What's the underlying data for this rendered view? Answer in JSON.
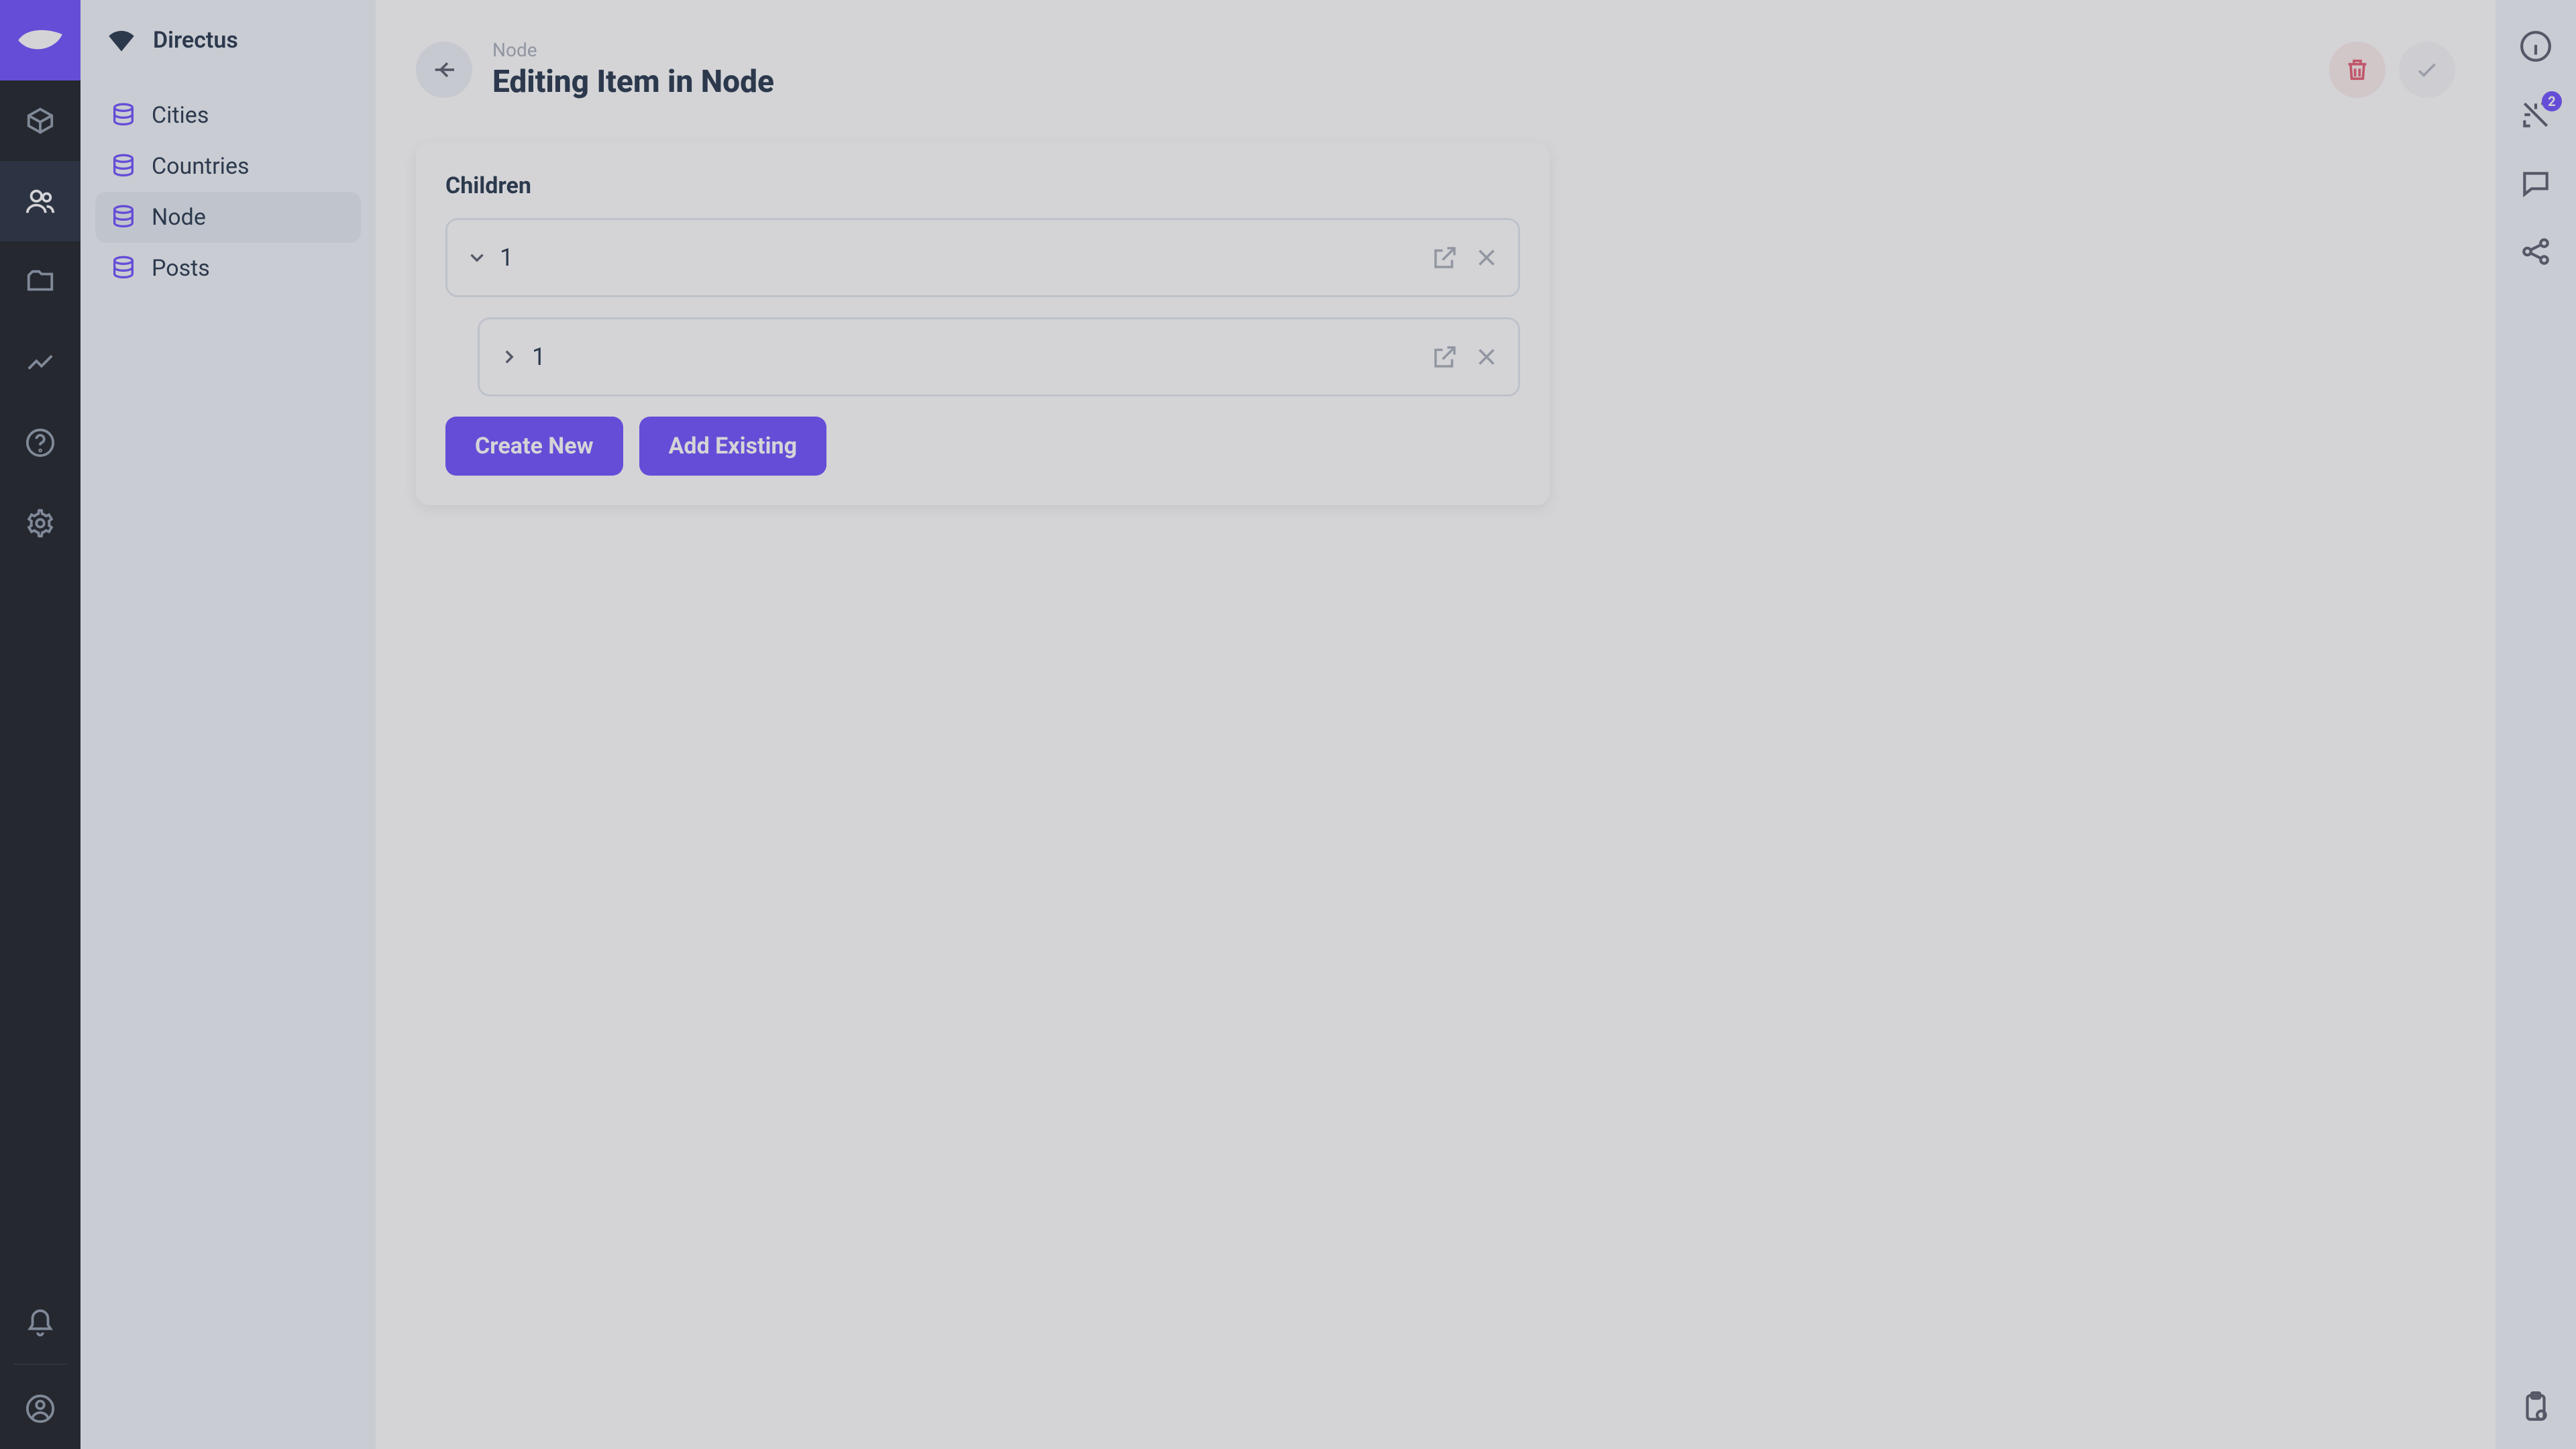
{
  "brand": "Directus",
  "nav": {
    "items": [
      "content",
      "users",
      "files",
      "insights",
      "help",
      "settings"
    ],
    "active_index": 1
  },
  "sidebar": {
    "title": "Directus",
    "collections": [
      {
        "label": "Cities",
        "active": false
      },
      {
        "label": "Countries",
        "active": false
      },
      {
        "label": "Node",
        "active": true
      },
      {
        "label": "Posts",
        "active": false
      }
    ]
  },
  "header": {
    "breadcrumb": "Node",
    "title": "Editing Item in Node"
  },
  "form": {
    "field_label": "Children",
    "items": [
      {
        "value": "1",
        "expanded": true
      },
      {
        "value": "1",
        "expanded": false,
        "nested": true
      }
    ],
    "create_label": "Create New",
    "add_existing_label": "Add Existing"
  },
  "right_rail": {
    "notification_count": "2"
  }
}
